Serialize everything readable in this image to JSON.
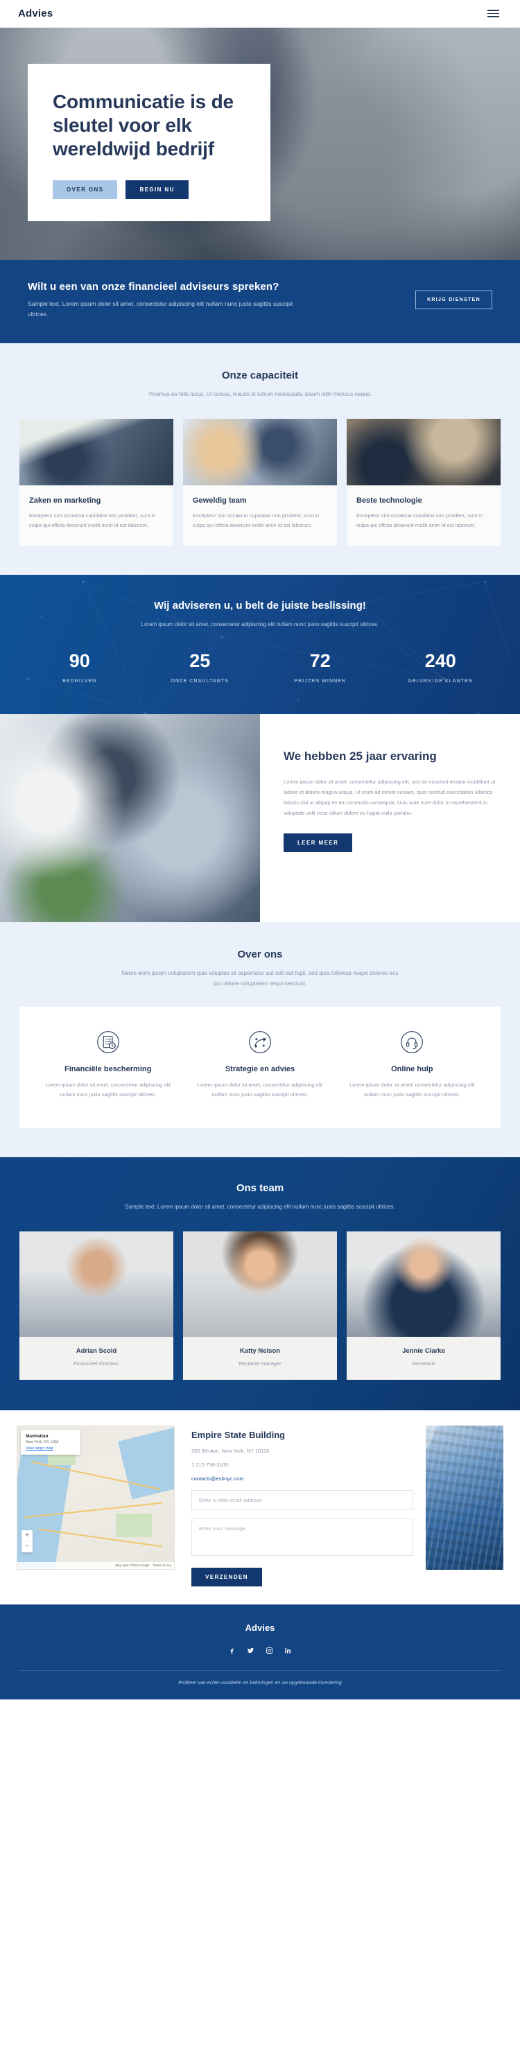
{
  "nav": {
    "brand": "Advies",
    "menu_icon": "hamburger-menu-icon"
  },
  "hero": {
    "title": "Communicatie is de sleutel voor elk wereldwijd bedrijf",
    "btn_secondary": "OVER ONS",
    "btn_primary": "BEGIN NU"
  },
  "cta": {
    "heading": "Wilt u een van onze financieel adviseurs spreken?",
    "text": "Sample text. Lorem ipsum dolor sit amet, consectetur adipiscing elit nullam nunc justo sagittis suscipit ultrices.",
    "button": "KRIJG DIENSTEN"
  },
  "capacity": {
    "heading": "Onze capaciteit",
    "sub": "Vivamus eu felis lacus. Ut cursus, mauris et rutrum malesuada, ipsum nibh rhoncus neque.",
    "cards": [
      {
        "title": "Zaken en marketing",
        "text": "Excepteur sint occaecat cupidatat non proident, sunt in culpa qui officia deserunt mollit anim id est laborum."
      },
      {
        "title": "Geweldig team",
        "text": "Excepteur sint occaecat cupidatat non proident, sunt in culpa qui officia deserunt mollit anim id est laborum."
      },
      {
        "title": "Beste technologie",
        "text": "Excepteur sint occaecat cupidatat non proident, sunt in culpa qui officia deserunt mollit anim id est laborum."
      }
    ]
  },
  "stats": {
    "heading": "Wij adviseren u, u belt de juiste beslissing!",
    "sub": "Lorem ipsum dolor sit amet, consectetur adipiscing elit nullam nunc justo sagittis suscipit ultrices.",
    "items": [
      {
        "value": "90",
        "label": "BEDRIJVEN"
      },
      {
        "value": "25",
        "label": "ONZE CNSULTANTS"
      },
      {
        "value": "72",
        "label": "PRIJZEN WINNEN"
      },
      {
        "value": "240",
        "label": "GELUKKIGE KLANTEN"
      }
    ]
  },
  "experience": {
    "heading": "We hebben 25 jaar ervaring",
    "text": "Lorem ipsum dolor sit amet, consectetur adipiscing elit, sed do eiusmod tempor incididunt ut labore et dolore magna aliqua. Ut enim ad minim veniam, quis nostrud exercitation ullamco laboris nisi ut aliquip ex ea commodo consequat. Duis aute irure dolor in reprehenderit in voluptate velit esse cillum dolore eu fugiat nulla pariatur.",
    "button": "LEER MEER"
  },
  "about": {
    "heading": "Over ons",
    "sub": "Nemo enim ipsam voluptatem quia voluptas sit aspernatur aut odit aut fugit, sed quia followup magni dolores eos qui ratione voluptatem sequi nesciunt.",
    "columns": [
      {
        "icon": "checklist-clock-icon",
        "title": "Financiële bescherming",
        "text": "Lorem ipsum dolor sit amet, consectetur adipiscing elit nullam nunc justo sagittis suscipit ultrices."
      },
      {
        "icon": "strategy-path-icon",
        "title": "Strategie en advies",
        "text": "Lorem ipsum dolor sit amet, consectetur adipiscing elit nullam nunc justo sagittis suscipit ultrices."
      },
      {
        "icon": "headset-support-icon",
        "title": "Online hulp",
        "text": "Lorem ipsum dolor sit amet, consectetur adipiscing elit nullam nunc justo sagittis suscipit ultrices."
      }
    ]
  },
  "team": {
    "heading": "Ons team",
    "sub": "Sample text. Lorem ipsum dolor sit amet, consectetur adipiscing elit nullam nunc justo sagittis suscipit ultrices.",
    "members": [
      {
        "name": "Adrian Scold",
        "role": "Financieel directeur"
      },
      {
        "name": "Katty Nelson",
        "role": "Reclame manager"
      },
      {
        "name": "Jennie Clarke",
        "role": "Secretaris"
      }
    ]
  },
  "contact": {
    "map": {
      "title": "Manhattan",
      "subtitle": "New York, NY, USA",
      "link": "View larger map",
      "zoom_in": "+",
      "zoom_out": "−",
      "attribution": "Map data ©2022 Google",
      "terms": "Terms of Use"
    },
    "building": "Empire State Building",
    "address": "350 5th Ave, New York, NY 10118",
    "phone": "1 212-736-3100",
    "email": "contacts@esbnyc.com",
    "email_placeholder": "Enter a valid email address",
    "message_placeholder": "Enter your message",
    "send_button": "VERZENDEN"
  },
  "footer": {
    "brand": "Advies",
    "socials": [
      "facebook-icon",
      "twitter-icon",
      "instagram-icon",
      "linkedin-icon"
    ],
    "tagline": "Profiteer van echte voordelen en beloningen en uw opgebouwde investering"
  },
  "colors": {
    "brand_blue": "#134584",
    "dark_navy": "#27395a",
    "light_blue": "#a8c6e8",
    "section_bg": "#eaf1fb"
  }
}
